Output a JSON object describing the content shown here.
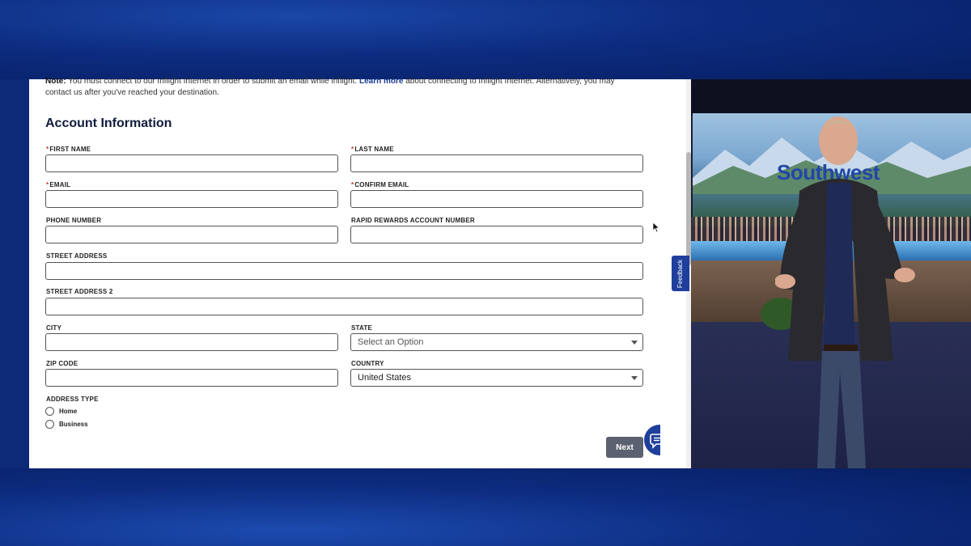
{
  "note": {
    "prefix": "Note:",
    "text_before": " You must connect to our Inflight Internet in order to submit an email while inflight. ",
    "link": "Learn more",
    "text_after": " about connecting to Inflight Internet. Alternatively, you may contact us after you've reached your destination."
  },
  "section_title": "Account Information",
  "fields": {
    "first_name": {
      "label": "FIRST NAME",
      "required": "*",
      "value": ""
    },
    "last_name": {
      "label": "LAST NAME",
      "required": "*",
      "value": ""
    },
    "email": {
      "label": "EMAIL",
      "required": "*",
      "value": ""
    },
    "confirm_email": {
      "label": "CONFIRM EMAIL",
      "required": "*",
      "value": ""
    },
    "phone": {
      "label": "PHONE NUMBER",
      "value": ""
    },
    "rapid_rewards": {
      "label": "RAPID REWARDS ACCOUNT NUMBER",
      "value": ""
    },
    "street": {
      "label": "STREET ADDRESS",
      "value": ""
    },
    "street2": {
      "label": "STREET ADDRESS 2",
      "value": ""
    },
    "city": {
      "label": "CITY",
      "value": ""
    },
    "state": {
      "label": "STATE",
      "selected": "Select an Option"
    },
    "zip": {
      "label": "ZIP CODE",
      "value": ""
    },
    "country": {
      "label": "COUNTRY",
      "selected": "United States"
    }
  },
  "address_type": {
    "label": "ADDRESS TYPE",
    "options": [
      "Home",
      "Business"
    ]
  },
  "buttons": {
    "next": "Next",
    "feedback": "Feedback"
  },
  "video": {
    "screen_logo": "Southwest"
  },
  "icons": {
    "chat": "chat-sparkle-icon",
    "cursor": "mouse-cursor-icon",
    "dropdown": "chevron-down-icon"
  },
  "colors": {
    "brand_blue": "#1f3f9c",
    "button_gray": "#5b6171",
    "required_red": "#c0392b"
  }
}
